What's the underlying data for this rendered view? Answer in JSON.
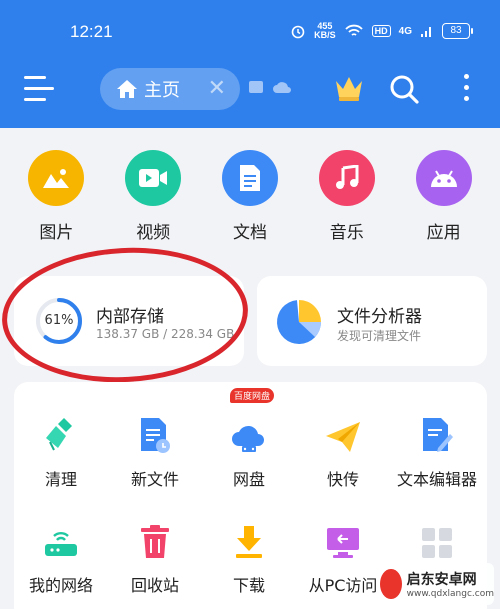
{
  "status_bar": {
    "time": "12:21",
    "speed_value": "455",
    "speed_unit": "KB/S",
    "hd": "HD",
    "network": "4G",
    "battery": "83"
  },
  "header": {
    "tab_label": "主页",
    "icons": [
      "menu-icon",
      "home-icon",
      "close-icon",
      "crown-icon",
      "search-icon",
      "more-icon"
    ]
  },
  "categories": [
    {
      "label": "图片",
      "icon": "image-icon",
      "color": "#f7b500"
    },
    {
      "label": "视频",
      "icon": "video-icon",
      "color": "#1ec8a0"
    },
    {
      "label": "文档",
      "icon": "document-icon",
      "color": "#3d8af7"
    },
    {
      "label": "音乐",
      "icon": "music-icon",
      "color": "#f2436a"
    },
    {
      "label": "应用",
      "icon": "android-icon",
      "color": "#a763f0"
    }
  ],
  "storage": {
    "title": "内部存储",
    "percent_label": "61%",
    "percent_value": 61,
    "usage": "138.37 GB / 228.34 GB"
  },
  "analyzer": {
    "title": "文件分析器",
    "subtitle": "发现可清理文件"
  },
  "tools": [
    {
      "label": "清理",
      "icon": "brush-icon"
    },
    {
      "label": "新文件",
      "icon": "new-file-icon"
    },
    {
      "label": "网盘",
      "icon": "cloud-disk-icon",
      "tag": "百度网盘"
    },
    {
      "label": "快传",
      "icon": "paper-plane-icon"
    },
    {
      "label": "文本编辑器",
      "icon": "text-editor-icon"
    },
    {
      "label": "我的网络",
      "icon": "router-icon"
    },
    {
      "label": "回收站",
      "icon": "trash-icon"
    },
    {
      "label": "下载",
      "icon": "download-icon"
    },
    {
      "label": "从PC访问",
      "icon": "pc-access-icon"
    },
    {
      "label": "",
      "icon": "more-grid-icon"
    }
  ],
  "watermark": {
    "name": "启东安卓网",
    "url": "www.qdxlangc.com"
  },
  "colors": {
    "header_bg": "#2f80ed",
    "ring": "#2f80ed",
    "annotation": "#d9252c"
  }
}
